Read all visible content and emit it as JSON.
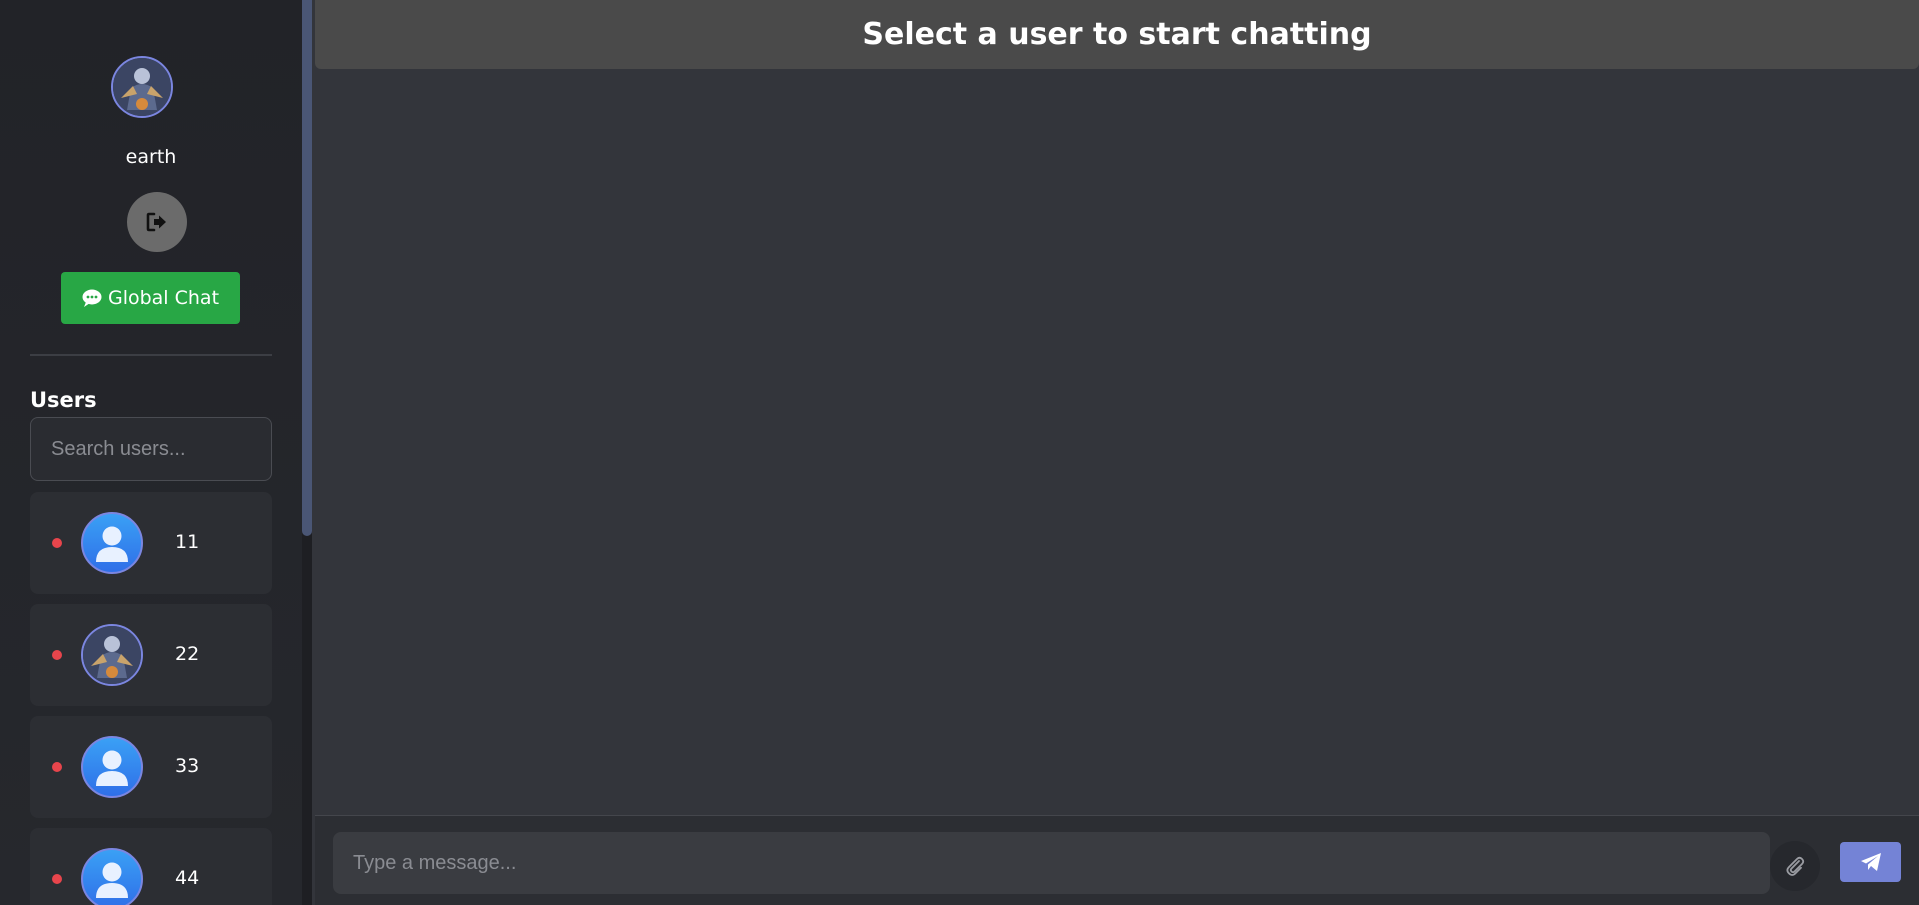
{
  "sidebar": {
    "profile": {
      "avatar": "user-profile-photo",
      "username": "earth"
    },
    "logout": {
      "icon": "logout-icon"
    },
    "global_chat": {
      "icon": "chat-bubble-icon",
      "label": "Global Chat"
    },
    "users_heading": "Users",
    "search": {
      "placeholder": "Search users...",
      "value": ""
    },
    "users": [
      {
        "name": "11",
        "status": "offline",
        "avatar": "default-user-icon"
      },
      {
        "name": "22",
        "status": "offline",
        "avatar": "user-profile-photo"
      },
      {
        "name": "33",
        "status": "offline",
        "avatar": "default-user-icon"
      },
      {
        "name": "44",
        "status": "offline",
        "avatar": "default-user-icon"
      }
    ]
  },
  "chat": {
    "header_title": "Select a user to start chatting",
    "input": {
      "placeholder": "Type a message...",
      "value": ""
    },
    "attach": {
      "icon": "paperclip-icon"
    },
    "send": {
      "icon": "send-icon"
    }
  },
  "colors": {
    "sidebar_bg": "#24262b",
    "main_bg": "#33353b",
    "header_bg": "#4a4a4a",
    "global_chat_green": "#28a745",
    "send_accent": "#7483d6",
    "status_offline": "#e8454c",
    "avatar_border": "#7b86e0"
  }
}
